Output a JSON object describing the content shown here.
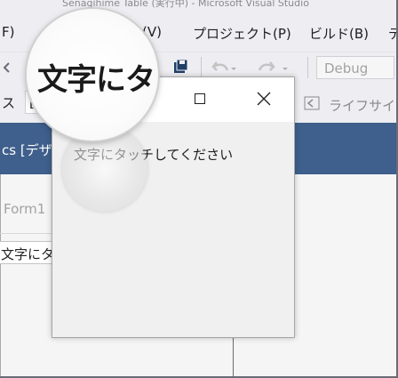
{
  "window_title": "Senagihime Table (実行中) - Microsoft Visual Studio",
  "menu": [
    {
      "label": "F)"
    },
    {
      "label": "(V)"
    },
    {
      "label": "プロジェクト(P)"
    },
    {
      "label": "ビルド(B)"
    },
    {
      "label": "デ"
    }
  ],
  "toolbar": {
    "config": "Debug"
  },
  "toolbar2": {
    "left_label": "ス",
    "field_value": "[",
    "lifecycle": "ライフサイク"
  },
  "doc_tab": {
    "label": "cs [デザイ"
  },
  "designer": {
    "form_label": "Form1",
    "grid_cell": "文字にタ"
  },
  "run_form": {
    "label": "文字にタッチしてください"
  },
  "magnifier": {
    "text": "文字にタッ"
  },
  "colors": {
    "chrome": "#eeeef2",
    "tab_strip": "#3f5f8c",
    "accent": "#1f3f66"
  }
}
